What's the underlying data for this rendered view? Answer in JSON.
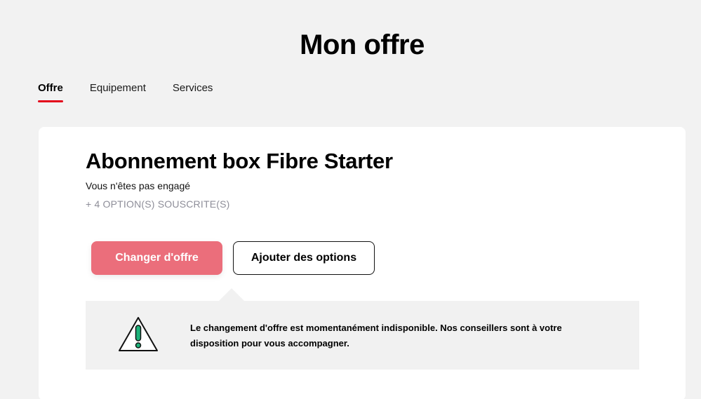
{
  "header": {
    "title": "Mon offre"
  },
  "tabs": [
    {
      "label": "Offre",
      "active": true
    },
    {
      "label": "Equipement",
      "active": false
    },
    {
      "label": "Services",
      "active": false
    }
  ],
  "offer": {
    "title": "Abonnement box Fibre Starter",
    "engagement": "Vous n'êtes pas engagé",
    "options_summary": "+ 4 OPTION(S) SOUSCRITE(S)"
  },
  "actions": {
    "change_offer_label": "Changer d'offre",
    "add_options_label": "Ajouter des options"
  },
  "notice": {
    "icon": "warning-triangle-icon",
    "text": "Le changement d'offre est momentanément indisponible. Nos conseillers sont à votre disposition pour vous accompagner."
  },
  "colors": {
    "accent": "#e3051b",
    "primary_button": "#eb6e7b",
    "warning_icon": "#1db37a",
    "background": "#f2f2f2"
  }
}
